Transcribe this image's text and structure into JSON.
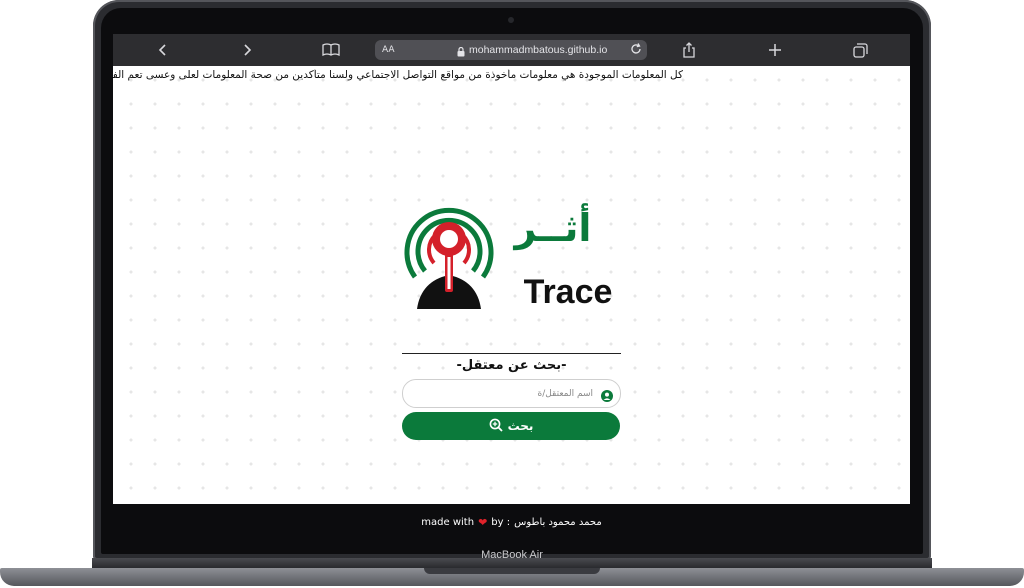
{
  "device": {
    "label": "MacBook Air"
  },
  "browser": {
    "url": "mohammadmbatous.github.io",
    "text_size_button": "AA",
    "icons": [
      "back-icon",
      "forward-icon",
      "reader-icon",
      "lock-icon",
      "reload-icon",
      "share-icon",
      "new-tab-icon",
      "tabs-icon"
    ]
  },
  "page": {
    "disclaimer": "كل المعلومات الموجودة هي معلومات مأخوذة من مواقع التواصل الاجتماعي ولسنا متأكدين من صحة المعلومات لعلى وعسى تعم الفائدة ويسعد",
    "logo": {
      "arabic": "أثــر",
      "english": "Trace"
    },
    "subtitle": "-بحث عن معتقل-",
    "search_input": {
      "placeholder": "أسم المعتقل/ة",
      "value": ""
    },
    "search_button_label": "بحث",
    "colors": {
      "brand_green": "#0b7a3b",
      "accent_red": "#d4202a",
      "icon_black": "#111111"
    }
  },
  "footer": {
    "made_with": "made with",
    "heart": "❤",
    "by": "by :",
    "author": "محمد محمود باطوس"
  }
}
